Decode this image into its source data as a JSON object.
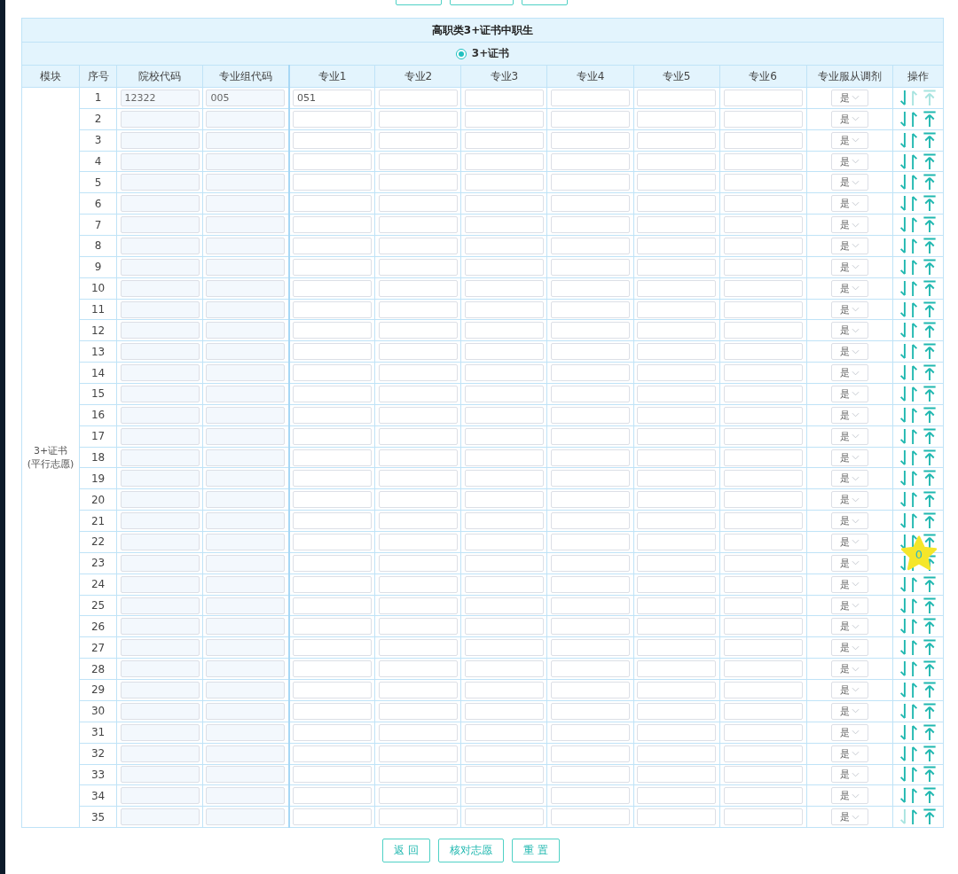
{
  "title": "高职类3+证书中职生",
  "options": [
    {
      "label": "3+证书",
      "selected": true
    }
  ],
  "columns": [
    "模块",
    "序号",
    "院校代码",
    "专业组代码",
    "专业1",
    "专业2",
    "专业3",
    "专业4",
    "专业5",
    "专业6",
    "专业服从调剂",
    "操作"
  ],
  "module": "3+证书\n(平行志愿)",
  "rows": [
    {
      "seq": "1",
      "school_code": "12322",
      "group_code": "005",
      "majors": [
        "051"
      ],
      "adjust": "是",
      "can_move_up": false,
      "can_move_down": true
    },
    {
      "seq": "2",
      "adjust": "是",
      "can_move_up": true,
      "can_move_down": true
    },
    {
      "seq": "3",
      "adjust": "是",
      "can_move_up": true,
      "can_move_down": true
    },
    {
      "seq": "4",
      "adjust": "是",
      "can_move_up": true,
      "can_move_down": true
    },
    {
      "seq": "5",
      "adjust": "是",
      "can_move_up": true,
      "can_move_down": true
    },
    {
      "seq": "6",
      "adjust": "是",
      "can_move_up": true,
      "can_move_down": true
    },
    {
      "seq": "7",
      "adjust": "是",
      "can_move_up": true,
      "can_move_down": true
    },
    {
      "seq": "8",
      "adjust": "是",
      "can_move_up": true,
      "can_move_down": true
    },
    {
      "seq": "9",
      "adjust": "是",
      "can_move_up": true,
      "can_move_down": true
    },
    {
      "seq": "10",
      "adjust": "是",
      "can_move_up": true,
      "can_move_down": true
    },
    {
      "seq": "11",
      "adjust": "是",
      "can_move_up": true,
      "can_move_down": true
    },
    {
      "seq": "12",
      "adjust": "是",
      "can_move_up": true,
      "can_move_down": true
    },
    {
      "seq": "13",
      "adjust": "是",
      "can_move_up": true,
      "can_move_down": true
    },
    {
      "seq": "14",
      "adjust": "是",
      "can_move_up": true,
      "can_move_down": true
    },
    {
      "seq": "15",
      "adjust": "是",
      "can_move_up": true,
      "can_move_down": true
    },
    {
      "seq": "16",
      "adjust": "是",
      "can_move_up": true,
      "can_move_down": true
    },
    {
      "seq": "17",
      "adjust": "是",
      "can_move_up": true,
      "can_move_down": true
    },
    {
      "seq": "18",
      "adjust": "是",
      "can_move_up": true,
      "can_move_down": true
    },
    {
      "seq": "19",
      "adjust": "是",
      "can_move_up": true,
      "can_move_down": true
    },
    {
      "seq": "20",
      "adjust": "是",
      "can_move_up": true,
      "can_move_down": true
    },
    {
      "seq": "21",
      "adjust": "是",
      "can_move_up": true,
      "can_move_down": true
    },
    {
      "seq": "22",
      "adjust": "是",
      "can_move_up": true,
      "can_move_down": true
    },
    {
      "seq": "23",
      "adjust": "是",
      "can_move_up": true,
      "can_move_down": true
    },
    {
      "seq": "24",
      "adjust": "是",
      "can_move_up": true,
      "can_move_down": true
    },
    {
      "seq": "25",
      "adjust": "是",
      "can_move_up": true,
      "can_move_down": true
    },
    {
      "seq": "26",
      "adjust": "是",
      "can_move_up": true,
      "can_move_down": true
    },
    {
      "seq": "27",
      "adjust": "是",
      "can_move_up": true,
      "can_move_down": true
    },
    {
      "seq": "28",
      "adjust": "是",
      "can_move_up": true,
      "can_move_down": true
    },
    {
      "seq": "29",
      "adjust": "是",
      "can_move_up": true,
      "can_move_down": true
    },
    {
      "seq": "30",
      "adjust": "是",
      "can_move_up": true,
      "can_move_down": true
    },
    {
      "seq": "31",
      "adjust": "是",
      "can_move_up": true,
      "can_move_down": true
    },
    {
      "seq": "32",
      "adjust": "是",
      "can_move_up": true,
      "can_move_down": true
    },
    {
      "seq": "33",
      "adjust": "是",
      "can_move_up": true,
      "can_move_down": true
    },
    {
      "seq": "34",
      "adjust": "是",
      "can_move_up": true,
      "can_move_down": true
    },
    {
      "seq": "35",
      "adjust": "是",
      "can_move_up": true,
      "can_move_down": false
    }
  ],
  "buttons": [
    "返 回",
    "核对志愿",
    "重 置"
  ],
  "star_badge": "0"
}
